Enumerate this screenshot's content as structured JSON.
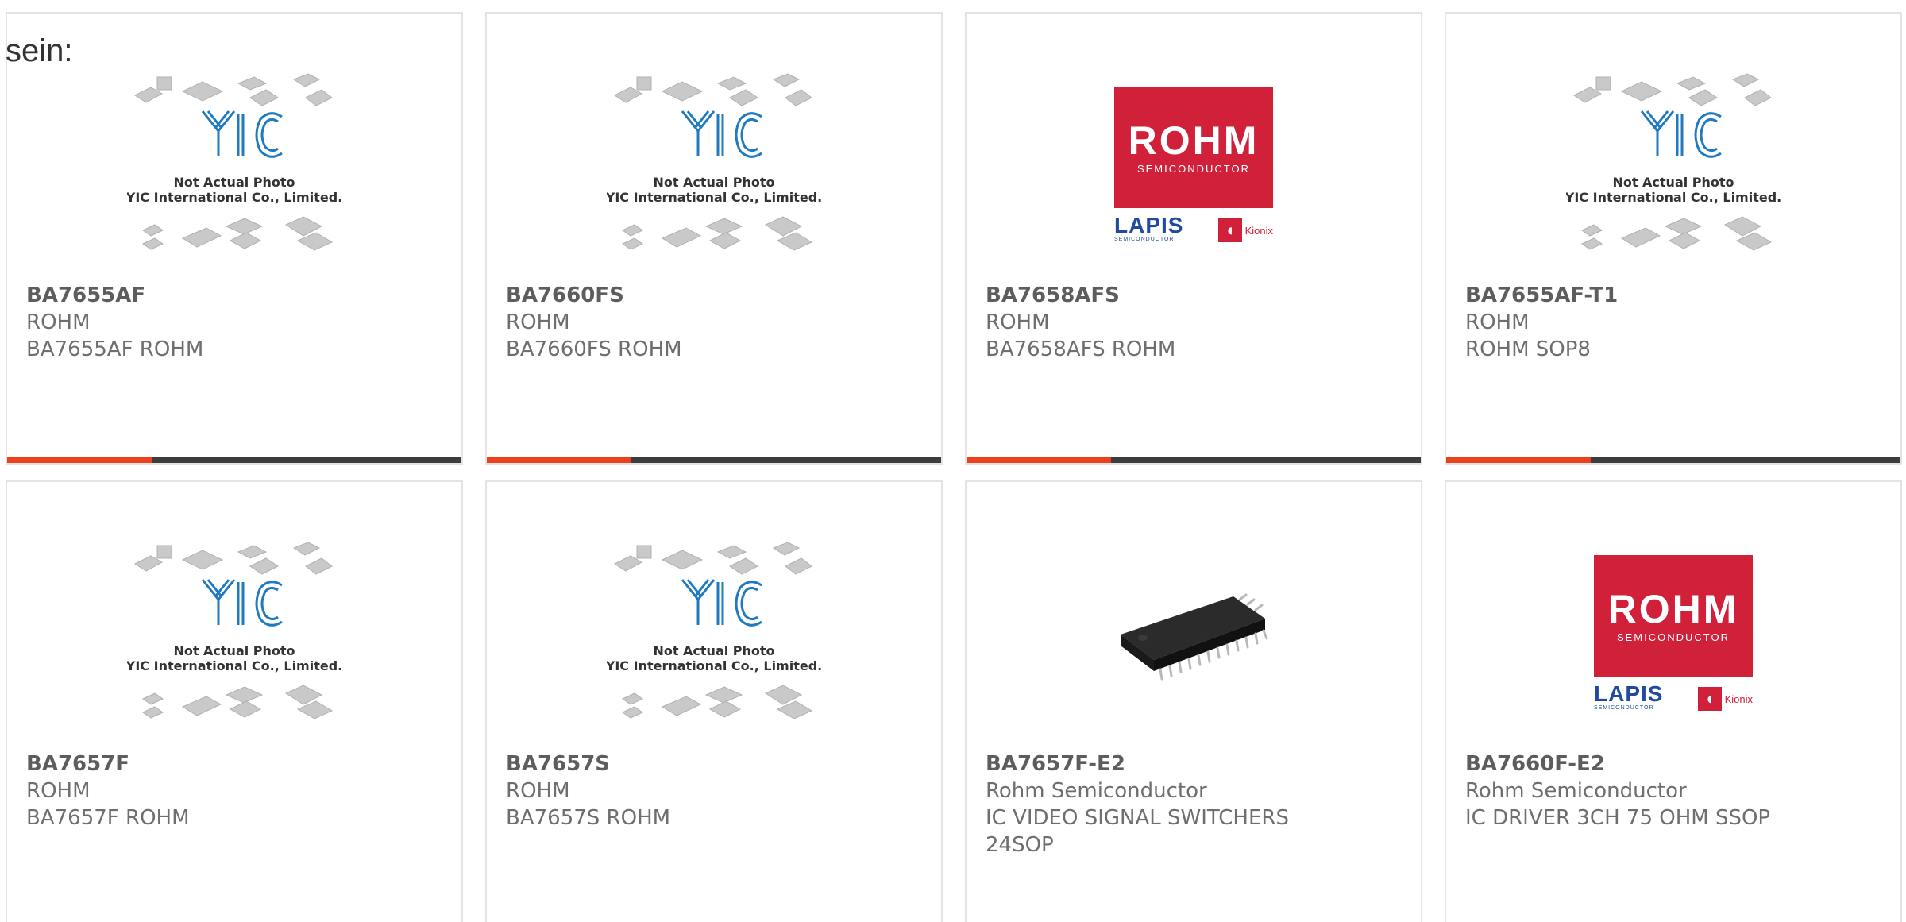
{
  "leadin_text": "sein:",
  "placeholder": {
    "logo_text": "YIC",
    "line1": "Not Actual Photo",
    "line2": "YIC International Co., Limited."
  },
  "rohm_logo": {
    "brand": "ROHM",
    "tagline": "SEMICONDUCTOR",
    "sub_brand": "LAPIS",
    "sub_tagline": "SEMICONDUCTOR",
    "partner": "Kionix"
  },
  "colors": {
    "accent": "#e8411c",
    "bar": "#3d3d3d",
    "rohm_red": "#d0203a"
  },
  "products": [
    {
      "part": "BA7655AF",
      "mfr": "ROHM",
      "desc": "BA7655AF ROHM",
      "image": "placeholder"
    },
    {
      "part": "BA7660FS",
      "mfr": "ROHM",
      "desc": "BA7660FS ROHM",
      "image": "placeholder"
    },
    {
      "part": "BA7658AFS",
      "mfr": "ROHM",
      "desc": "BA7658AFS ROHM",
      "image": "rohm-logo"
    },
    {
      "part": "BA7655AF-T1",
      "mfr": "ROHM",
      "desc": "ROHM SOP8",
      "image": "placeholder"
    },
    {
      "part": "BA7657F",
      "mfr": "ROHM",
      "desc": "BA7657F ROHM",
      "image": "placeholder"
    },
    {
      "part": "BA7657S",
      "mfr": "ROHM",
      "desc": "BA7657S ROHM",
      "image": "placeholder"
    },
    {
      "part": "BA7657F-E2",
      "mfr": "Rohm Semiconductor",
      "desc": "IC VIDEO SIGNAL SWITCHERS 24SOP",
      "image": "ic-chip-photo"
    },
    {
      "part": "BA7660F-E2",
      "mfr": "Rohm Semiconductor",
      "desc": "IC DRIVER 3CH 75 OHM SSOP",
      "image": "rohm-logo"
    }
  ]
}
